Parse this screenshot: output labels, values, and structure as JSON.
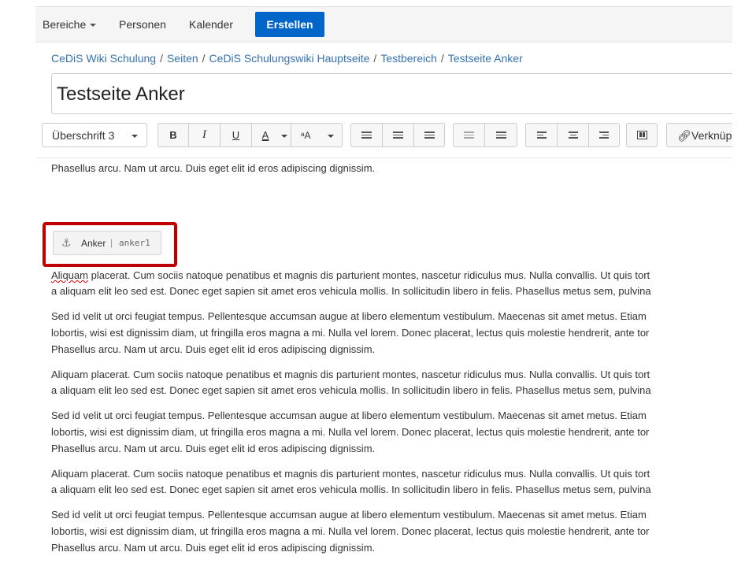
{
  "nav": {
    "items": [
      "Bereiche",
      "Personen",
      "Kalender"
    ],
    "create_label": "Erstellen"
  },
  "breadcrumb": [
    "CeDiS Wiki Schulung",
    "Seiten",
    "CeDiS Schulungswiki Hauptseite",
    "Testbereich",
    "Testseite Anker"
  ],
  "page": {
    "title": "Testseite Anker"
  },
  "toolbar": {
    "style_select": "Überschrift 3",
    "bold": "B",
    "italic": "I",
    "underline": "U",
    "color": "A",
    "format": "ᵃA",
    "link_label": "Verknüp"
  },
  "content": {
    "top_line": "Phasellus arcu. Nam ut arcu. Duis eget elit id eros adipiscing dignissim.",
    "anchor": {
      "name": "Anker",
      "value": "anker1"
    },
    "para_a_first_word": "Aliquam",
    "para_a_line1_rest": " placerat. Cum sociis natoque penatibus et magnis dis parturient montes, nascetur ridiculus mus. Nulla convallis. Ut quis tort",
    "para_a_line1": "Aliquam placerat. Cum sociis natoque penatibus et magnis dis parturient montes, nascetur ridiculus mus. Nulla convallis. Ut quis tort",
    "para_a_line2": "a aliquam elit leo sed est. Donec eget sapien sit amet eros vehicula mollis. In sollicitudin libero in felis. Phasellus metus sem, pulvina",
    "para_b_line1": "Sed id velit ut orci feugiat tempus. Pellentesque accumsan augue at libero elementum vestibulum. Maecenas sit amet metus. Etiam",
    "para_b_line2": "lobortis, wisi est dignissim diam, ut fringilla eros magna a mi. Nulla vel lorem. Donec placerat, lectus quis molestie hendrerit, ante tor",
    "para_b_line3": "Phasellus arcu. Nam ut arcu. Duis eget elit id eros adipiscing dignissim."
  },
  "colors": {
    "accent": "#0065c9",
    "link": "#3572b0",
    "highlight": "#c00000"
  }
}
